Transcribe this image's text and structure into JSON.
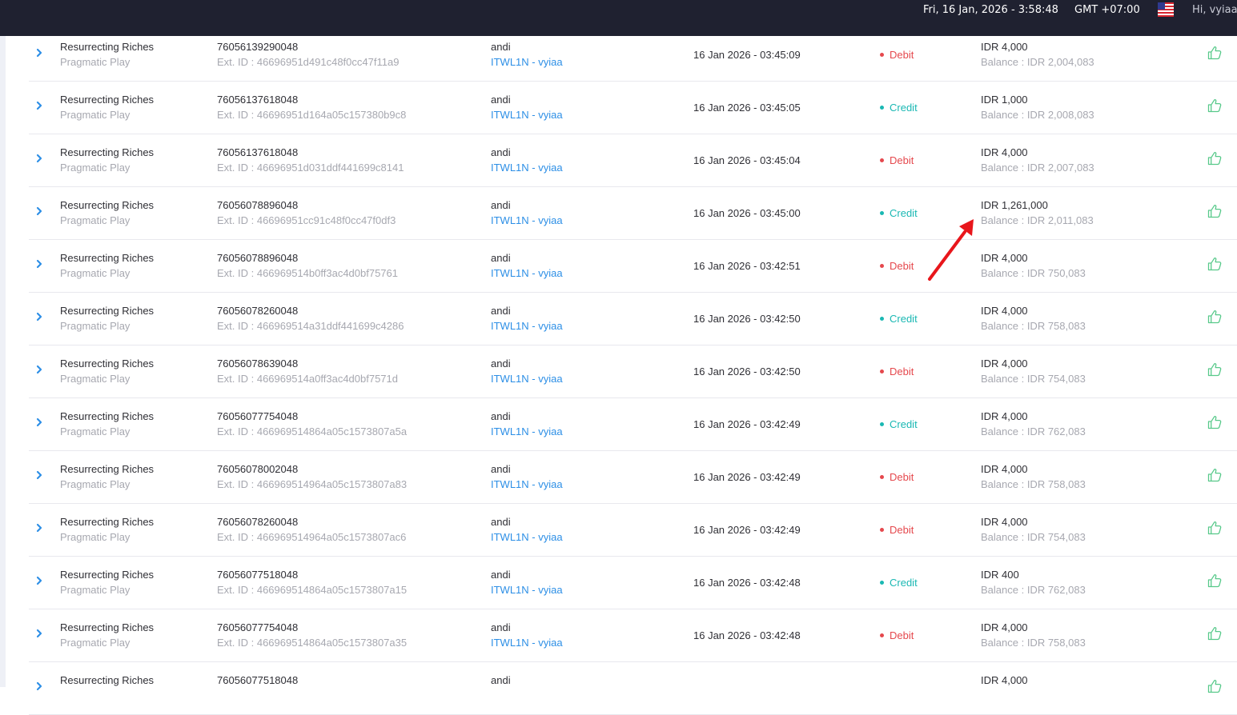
{
  "header": {
    "datetime": "Fri, 16 Jan, 2026 - 3:58:48",
    "timezone": "GMT +07:00",
    "flag_icon": "us-flag-icon",
    "greeting": "Hi, vyiaa"
  },
  "colors": {
    "topbar": "#1f2130",
    "debit": "#e5484d",
    "credit": "#1ab8b3",
    "link": "#2d8fe6",
    "thumb": "#58c98a",
    "arrow": "#e8161b"
  },
  "rows": [
    {
      "game": "Resurrecting Riches",
      "provider": "Pragmatic Play",
      "txid": "76056139290048",
      "ext": "Ext. ID : 46696951d491c48f0cc47f11a9",
      "player": "andi",
      "agent": "ITWL1N - vyiaa",
      "date": "16 Jan 2026 - 03:45:09",
      "type": "Debit",
      "amount": "IDR 4,000",
      "balance": "Balance : IDR 2,004,083"
    },
    {
      "game": "Resurrecting Riches",
      "provider": "Pragmatic Play",
      "txid": "76056137618048",
      "ext": "Ext. ID : 46696951d164a05c157380b9c8",
      "player": "andi",
      "agent": "ITWL1N - vyiaa",
      "date": "16 Jan 2026 - 03:45:05",
      "type": "Credit",
      "amount": "IDR 1,000",
      "balance": "Balance : IDR 2,008,083"
    },
    {
      "game": "Resurrecting Riches",
      "provider": "Pragmatic Play",
      "txid": "76056137618048",
      "ext": "Ext. ID : 46696951d031ddf441699c8141",
      "player": "andi",
      "agent": "ITWL1N - vyiaa",
      "date": "16 Jan 2026 - 03:45:04",
      "type": "Debit",
      "amount": "IDR 4,000",
      "balance": "Balance : IDR 2,007,083"
    },
    {
      "game": "Resurrecting Riches",
      "provider": "Pragmatic Play",
      "txid": "76056078896048",
      "ext": "Ext. ID : 46696951cc91c48f0cc47f0df3",
      "player": "andi",
      "agent": "ITWL1N - vyiaa",
      "date": "16 Jan 2026 - 03:45:00",
      "type": "Credit",
      "amount": "IDR 1,261,000",
      "balance": "Balance : IDR 2,011,083"
    },
    {
      "game": "Resurrecting Riches",
      "provider": "Pragmatic Play",
      "txid": "76056078896048",
      "ext": "Ext. ID : 466969514b0ff3ac4d0bf75761",
      "player": "andi",
      "agent": "ITWL1N - vyiaa",
      "date": "16 Jan 2026 - 03:42:51",
      "type": "Debit",
      "amount": "IDR 4,000",
      "balance": "Balance : IDR 750,083"
    },
    {
      "game": "Resurrecting Riches",
      "provider": "Pragmatic Play",
      "txid": "76056078260048",
      "ext": "Ext. ID : 466969514a31ddf441699c4286",
      "player": "andi",
      "agent": "ITWL1N - vyiaa",
      "date": "16 Jan 2026 - 03:42:50",
      "type": "Credit",
      "amount": "IDR 4,000",
      "balance": "Balance : IDR 758,083"
    },
    {
      "game": "Resurrecting Riches",
      "provider": "Pragmatic Play",
      "txid": "76056078639048",
      "ext": "Ext. ID : 466969514a0ff3ac4d0bf7571d",
      "player": "andi",
      "agent": "ITWL1N - vyiaa",
      "date": "16 Jan 2026 - 03:42:50",
      "type": "Debit",
      "amount": "IDR 4,000",
      "balance": "Balance : IDR 754,083"
    },
    {
      "game": "Resurrecting Riches",
      "provider": "Pragmatic Play",
      "txid": "76056077754048",
      "ext": "Ext. ID : 466969514864a05c1573807a5a",
      "player": "andi",
      "agent": "ITWL1N - vyiaa",
      "date": "16 Jan 2026 - 03:42:49",
      "type": "Credit",
      "amount": "IDR 4,000",
      "balance": "Balance : IDR 762,083"
    },
    {
      "game": "Resurrecting Riches",
      "provider": "Pragmatic Play",
      "txid": "76056078002048",
      "ext": "Ext. ID : 466969514964a05c1573807a83",
      "player": "andi",
      "agent": "ITWL1N - vyiaa",
      "date": "16 Jan 2026 - 03:42:49",
      "type": "Debit",
      "amount": "IDR 4,000",
      "balance": "Balance : IDR 758,083"
    },
    {
      "game": "Resurrecting Riches",
      "provider": "Pragmatic Play",
      "txid": "76056078260048",
      "ext": "Ext. ID : 466969514964a05c1573807ac6",
      "player": "andi",
      "agent": "ITWL1N - vyiaa",
      "date": "16 Jan 2026 - 03:42:49",
      "type": "Debit",
      "amount": "IDR 4,000",
      "balance": "Balance : IDR 754,083"
    },
    {
      "game": "Resurrecting Riches",
      "provider": "Pragmatic Play",
      "txid": "76056077518048",
      "ext": "Ext. ID : 466969514864a05c1573807a15",
      "player": "andi",
      "agent": "ITWL1N - vyiaa",
      "date": "16 Jan 2026 - 03:42:48",
      "type": "Credit",
      "amount": "IDR 400",
      "balance": "Balance : IDR 762,083"
    },
    {
      "game": "Resurrecting Riches",
      "provider": "Pragmatic Play",
      "txid": "76056077754048",
      "ext": "Ext. ID : 466969514864a05c1573807a35",
      "player": "andi",
      "agent": "ITWL1N - vyiaa",
      "date": "16 Jan 2026 - 03:42:48",
      "type": "Debit",
      "amount": "IDR 4,000",
      "balance": "Balance : IDR 758,083"
    },
    {
      "game": "Resurrecting Riches",
      "provider": "",
      "txid": "76056077518048",
      "ext": "",
      "player": "andi",
      "agent": "",
      "date": "",
      "type": "",
      "amount": "IDR 4,000",
      "balance": ""
    }
  ]
}
